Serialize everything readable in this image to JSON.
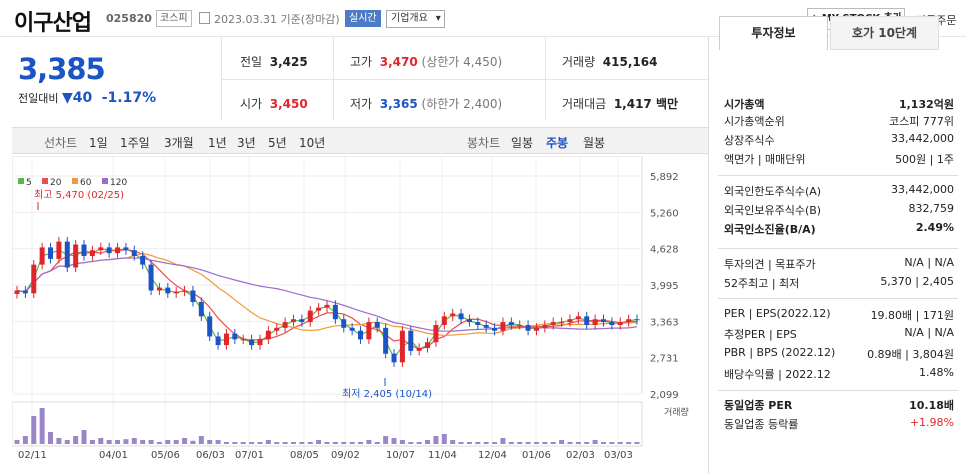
{
  "header": {
    "title": "이구산업",
    "code": "025820",
    "market": "코스피",
    "date": "2023.03.31 기준(장마감)",
    "live": "실시간",
    "biz": "기업개요",
    "mystock": "+ MY STOCK 추가",
    "quick": "빠른주문"
  },
  "quote": {
    "price": "3,385",
    "change_label": "전일대비",
    "change_value": "40",
    "change_pct": "-1.17%",
    "prev_label": "전일",
    "prev": "3,425",
    "high_label": "고가",
    "high": "3,470",
    "high_limit": "(상한가 4,450)",
    "volume_label": "거래량",
    "volume": "415,164",
    "open_label": "시가",
    "open": "3,450",
    "low_label": "저가",
    "low": "3,365",
    "low_limit": "(하한가 2,400)",
    "amount_label": "거래대금",
    "amount": "1,417 백만"
  },
  "period_tabs": {
    "label": "선차트",
    "items": [
      "1일",
      "1주일",
      "3개월",
      "1년",
      "3년",
      "5년",
      "10년"
    ],
    "candle_label": "봉차트",
    "candle_items": [
      "일봉",
      "주봉",
      "월봉"
    ],
    "active": "주봉"
  },
  "chart_data": {
    "type": "candlestick",
    "legend": [
      "5",
      "20",
      "60",
      "120"
    ],
    "colors": {
      "5": "#56b84a",
      "20": "#e84e4e",
      "60": "#f09a3a",
      "120": "#9b6bd0",
      "up": "#e0262b",
      "down": "#1c54c6",
      "volume": "#9b87c8"
    },
    "y_ticks": [
      "5,892",
      "5,260",
      "4,628",
      "3,995",
      "3,363",
      "2,731",
      "2,099"
    ],
    "ylim": [
      2099,
      5892
    ],
    "x_ticks": [
      "02/11",
      "04/01",
      "05/06",
      "06/03",
      "07/01",
      "08/05",
      "09/02",
      "10/07",
      "11/04",
      "12/04",
      "01/06",
      "02/03",
      "03/03"
    ],
    "high_note": "최고 5,470 (02/25)",
    "low_note": "최저 2,405 (10/14)",
    "volume_label": "거래량",
    "closes": [
      3900,
      3850,
      4350,
      4650,
      4450,
      4750,
      4300,
      4700,
      4500,
      4600,
      4650,
      4550,
      4650,
      4600,
      4500,
      4350,
      3900,
      3950,
      3850,
      3880,
      3900,
      3700,
      3450,
      3100,
      2950,
      3150,
      3050,
      3050,
      2950,
      3050,
      3200,
      3250,
      3350,
      3400,
      3350,
      3550,
      3600,
      3650,
      3400,
      3250,
      3200,
      3050,
      3350,
      3250,
      2800,
      2650,
      3200,
      2850,
      2900,
      3000,
      3300,
      3450,
      3500,
      3400,
      3350,
      3300,
      3250,
      3200,
      3350,
      3300,
      3300,
      3200,
      3250,
      3300,
      3350,
      3350,
      3400,
      3450,
      3300,
      3400,
      3350,
      3300,
      3350,
      3400,
      3385
    ],
    "volumes": [
      0.1,
      0.2,
      0.7,
      0.9,
      0.3,
      0.15,
      0.1,
      0.2,
      0.35,
      0.1,
      0.15,
      0.1,
      0.1,
      0.12,
      0.15,
      0.1,
      0.1,
      0.05,
      0.1,
      0.1,
      0.15,
      0.08,
      0.2,
      0.1,
      0.1,
      0.05,
      0.05,
      0.05,
      0.05,
      0.05,
      0.1,
      0.05,
      0.05,
      0.05,
      0.05,
      0.05,
      0.1,
      0.05,
      0.05,
      0.05,
      0.05,
      0.05,
      0.1,
      0.05,
      0.2,
      0.15,
      0.1,
      0.05,
      0.05,
      0.1,
      0.2,
      0.25,
      0.1,
      0.05,
      0.05,
      0.05,
      0.05,
      0.05,
      0.15,
      0.05,
      0.05,
      0.05,
      0.05,
      0.05,
      0.05,
      0.1,
      0.05,
      0.05,
      0.05,
      0.1,
      0.05,
      0.05,
      0.05,
      0.05,
      0.05
    ]
  },
  "invest": {
    "tab1": "투자정보",
    "tab2": "호가 10단계",
    "rows": [
      {
        "k": "시가총액",
        "v": "1,132억원",
        "bold": true
      },
      {
        "k": "시가총액순위",
        "v": "코스피  777위"
      },
      {
        "k": "상장주식수",
        "v": "33,442,000"
      },
      {
        "k": "액면가 | 매매단위",
        "v": "500원 | 1주"
      },
      {
        "k": "외국인한도주식수(A)",
        "v": "33,442,000"
      },
      {
        "k": "외국인보유주식수(B)",
        "v": "832,759"
      },
      {
        "k": "외국인소진율(B/A)",
        "v": "2.49%",
        "bold": true
      },
      {
        "k": "투자의견 | 목표주가",
        "v": "N/A | N/A"
      },
      {
        "k": "52주최고 | 최저",
        "v": "5,370 | 2,405"
      },
      {
        "k": "PER | EPS(2022.12)",
        "v": "19.80배 | 171원"
      },
      {
        "k": "추정PER | EPS",
        "v": "N/A | N/A"
      },
      {
        "k": "PBR | BPS (2022.12)",
        "v": "0.89배 | 3,804원"
      },
      {
        "k": "배당수익률 | 2022.12",
        "v": "1.48%"
      },
      {
        "k": "동일업종 PER",
        "v": "10.18배",
        "bold": true
      },
      {
        "k": "동일업종 등락률",
        "v": "+1.98%",
        "red": true
      }
    ]
  }
}
